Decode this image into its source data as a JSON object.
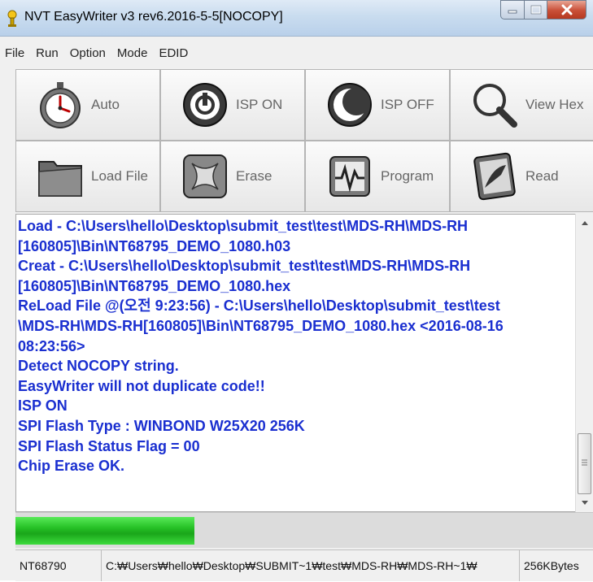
{
  "window": {
    "title": "NVT EasyWriter v3 rev6.2016-5-5[NOCOPY]"
  },
  "menu": [
    "File",
    "Run",
    "Option",
    "Mode",
    "EDID"
  ],
  "toolbar": {
    "auto": {
      "label": "Auto",
      "icon": "stopwatch-icon"
    },
    "isp_on": {
      "label": "ISP ON",
      "icon": "power-on-icon"
    },
    "isp_off": {
      "label": "ISP OFF",
      "icon": "moon-icon"
    },
    "view_hex": {
      "label": "View Hex",
      "icon": "magnifier-icon"
    },
    "load_file": {
      "label": "Load File",
      "icon": "folder-icon"
    },
    "erase": {
      "label": "Erase",
      "icon": "erase-icon"
    },
    "program": {
      "label": "Program",
      "icon": "program-icon"
    },
    "read": {
      "label": "Read",
      "icon": "read-icon"
    }
  },
  "log": {
    "lines": [
      "Load - C:\\Users\\hello\\Desktop\\submit_test\\test\\MDS-RH\\MDS-RH",
      "[160805]\\Bin\\NT68795_DEMO_1080.h03",
      "Creat - C:\\Users\\hello\\Desktop\\submit_test\\test\\MDS-RH\\MDS-RH",
      "[160805]\\Bin\\NT68795_DEMO_1080.hex",
      "ReLoad File @(오전 9:23:56) - C:\\Users\\hello\\Desktop\\submit_test\\test",
      "\\MDS-RH\\MDS-RH[160805]\\Bin\\NT68795_DEMO_1080.hex <2016-08-16",
      "08:23:56>",
      "Detect NOCOPY string.",
      "EasyWriter will not duplicate code!!",
      "ISP ON",
      "SPI Flash Type : WINBOND W25X20 256K",
      "SPI Flash Status Flag = 00",
      "Chip Erase OK."
    ]
  },
  "progress": {
    "fraction": 0.31,
    "color": "#25c025"
  },
  "status": {
    "chip": "NT68790",
    "path": "C:₩Users₩hello₩Desktop₩SUBMIT~1₩test₩MDS-RH₩MDS-RH~1₩",
    "size": "256KBytes"
  },
  "colors": {
    "log_text": "#1a2fd0",
    "titlebar": "#c9dcef",
    "close": "#c94f37"
  }
}
